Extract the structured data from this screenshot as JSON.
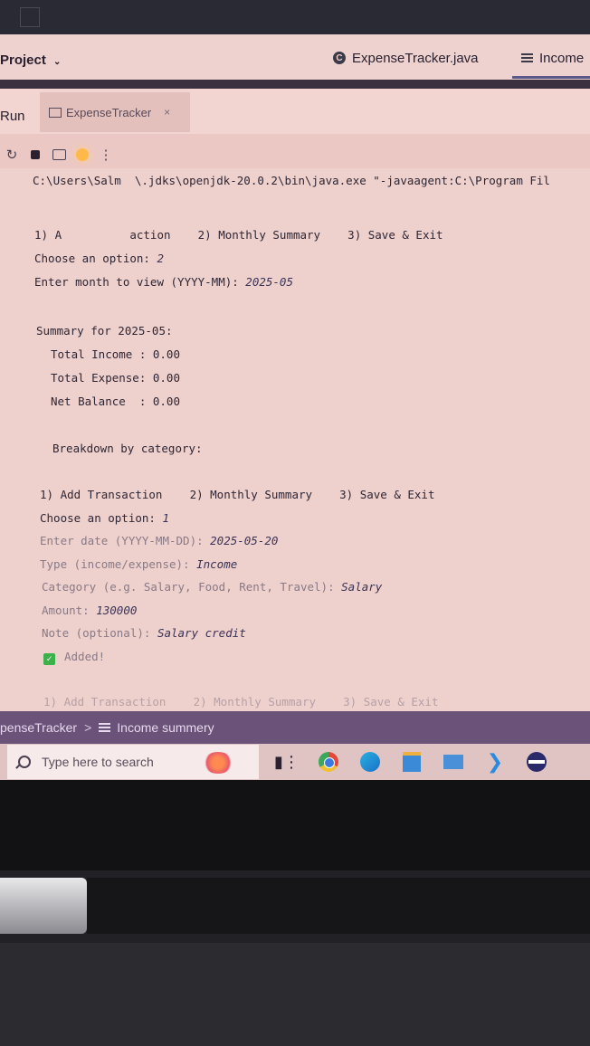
{
  "ide": {
    "project_label": "Project",
    "tabs": [
      {
        "label": "ExpenseTracker.java",
        "icon": "class-icon"
      },
      {
        "label": "Income",
        "icon": "text-file-icon"
      }
    ],
    "run_label": "Run",
    "run_tab": "ExpenseTracker"
  },
  "console": {
    "command": "C:\\Users\\Salm  \\.jdks\\openjdk-20.0.2\\bin\\java.exe \"-javaagent:C:\\Program Fil",
    "menu1": "1) A          action    2) Monthly Summary    3) Save & Exit",
    "choose1": "Choose an option: ",
    "choose1_val": "2",
    "month_prompt": "Enter month to view (YYYY-MM): ",
    "month_val": "2025-05",
    "summary_title": "Summary for 2025-05:",
    "total_income": "Total Income : 0.00",
    "total_expense": "Total Expense: 0.00",
    "net_balance": "Net Balance  : 0.00",
    "breakdown": "Breakdown by category:",
    "menu2": "1) Add Transaction    2) Monthly Summary    3) Save & Exit",
    "choose2": "Choose an option: ",
    "choose2_val": "1",
    "date_prompt": "Enter date (YYYY-MM-DD): ",
    "date_val": "2025-05-20",
    "type_prompt": "Type (income/expense): ",
    "type_val": "Income",
    "category_prompt": "Category (e.g. Salary, Food, Rent, Travel): ",
    "category_val": "Salary",
    "amount_prompt": "Amount: ",
    "amount_val": "130000",
    "note_prompt": "Note (optional): ",
    "note_val": "Salary credit",
    "added": "Added!",
    "menu3": "1) Add Transaction    2) Monthly Summary    3) Save & Exit"
  },
  "breadcrumb": {
    "item1": "penseTracker",
    "separator": ">",
    "item2": "Income summery"
  },
  "taskbar": {
    "search_placeholder": "Type here to search",
    "icons": [
      "task-view-icon",
      "chrome-icon",
      "edge-icon",
      "store-icon",
      "mail-icon",
      "vscode-icon",
      "eclipse-icon"
    ]
  }
}
